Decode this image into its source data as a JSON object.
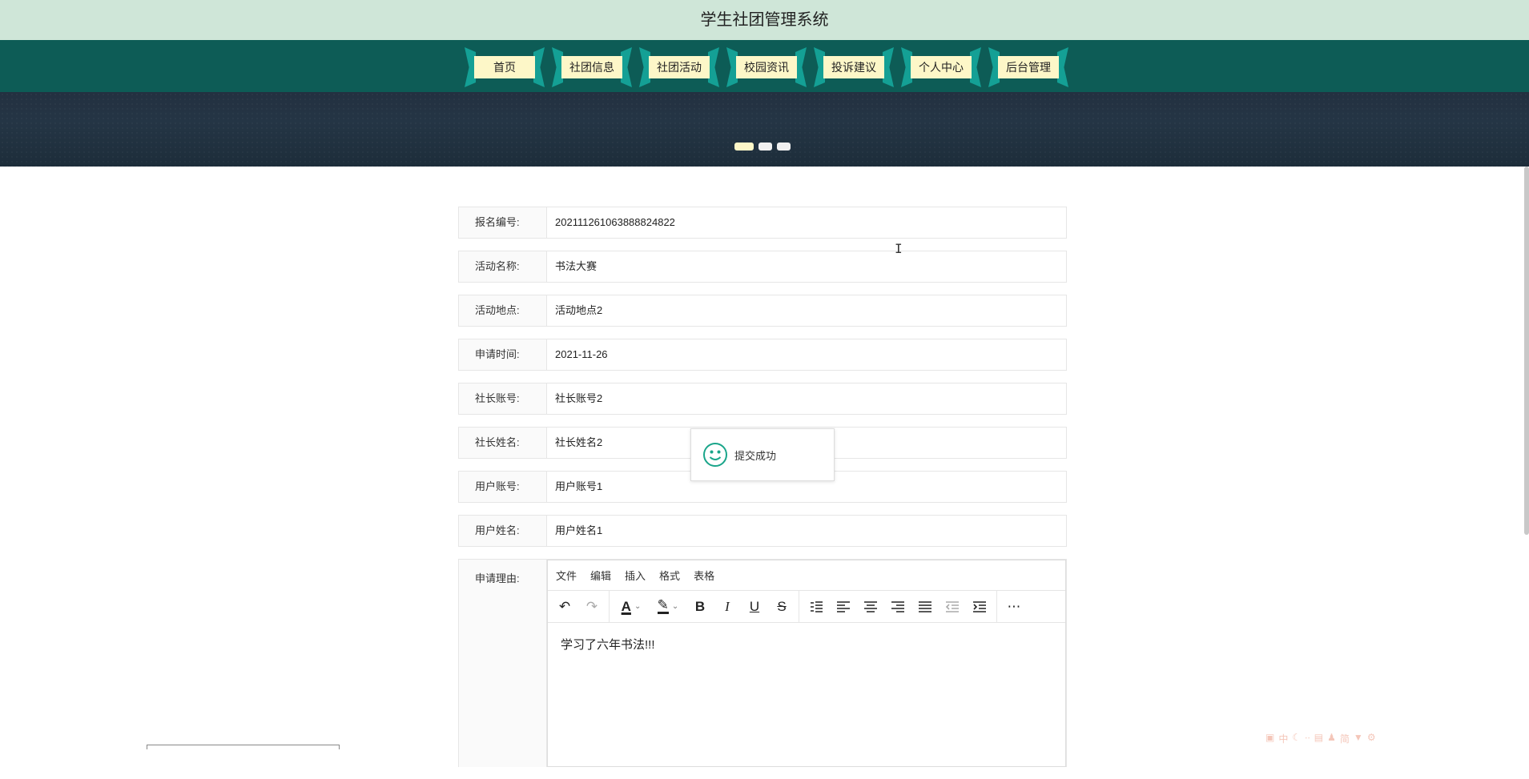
{
  "site": {
    "title": "学生社团管理系统"
  },
  "nav": {
    "items": [
      {
        "label": "首页"
      },
      {
        "label": "社团信息"
      },
      {
        "label": "社团活动"
      },
      {
        "label": "校园资讯"
      },
      {
        "label": "投诉建议"
      },
      {
        "label": "个人中心"
      },
      {
        "label": "后台管理"
      }
    ]
  },
  "carousel": {
    "slide_count": 3,
    "active_index": 0
  },
  "form": {
    "fields": [
      {
        "label": "报名编号:",
        "value": "202111261063888824822"
      },
      {
        "label": "活动名称:",
        "value": "书法大赛"
      },
      {
        "label": "活动地点:",
        "value": "活动地点2"
      },
      {
        "label": "申请时间:",
        "value": "2021-11-26"
      },
      {
        "label": "社长账号:",
        "value": "社长账号2"
      },
      {
        "label": "社长姓名:",
        "value": "社长姓名2"
      },
      {
        "label": "用户账号:",
        "value": "用户账号1"
      },
      {
        "label": "用户姓名:",
        "value": "用户姓名1"
      }
    ],
    "reason": {
      "label": "申请理由:",
      "menu": [
        "文件",
        "编辑",
        "插入",
        "格式",
        "表格"
      ],
      "content": "学习了六年书法!!!"
    }
  },
  "toolbar_icons": [
    "undo-icon",
    "redo-icon",
    "text-color-icon",
    "highlight-icon",
    "bold-icon",
    "italic-icon",
    "underline-icon",
    "strikethrough-icon",
    "line-height-icon",
    "align-left-icon",
    "align-center-icon",
    "align-right-icon",
    "justify-icon",
    "outdent-icon",
    "indent-icon",
    "more-icon"
  ],
  "toast": {
    "text": "提交成功",
    "icon": "smiley-icon"
  },
  "colors": {
    "header_bg": "#cfe6d8",
    "nav_bg": "#0d5c56",
    "nav_ribbon": "#14a095",
    "nav_label_bg": "#fdf7c8",
    "toast_icon": "#1aa58a"
  }
}
